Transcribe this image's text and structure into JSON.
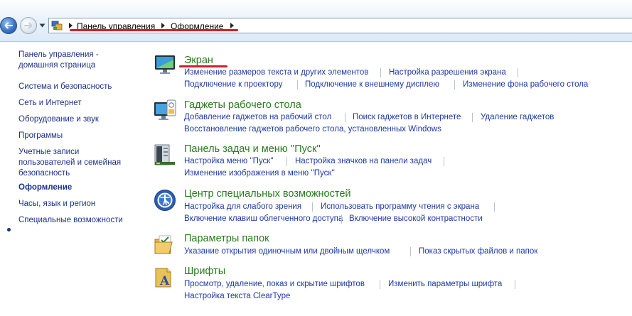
{
  "breadcrumb": {
    "items": [
      "Панель управления",
      "Оформление"
    ]
  },
  "sidebar": {
    "items": [
      {
        "label": "Панель управления -\nдомашняя страница"
      },
      {
        "label": "Система и безопасность"
      },
      {
        "label": "Сеть и Интернет"
      },
      {
        "label": "Оборудование и звук"
      },
      {
        "label": "Программы"
      },
      {
        "label": "Учетные записи\nпользователей и семейная\nбезопасность"
      },
      {
        "label": "Оформление",
        "current": true
      },
      {
        "label": "Часы, язык и регион"
      },
      {
        "label": "Специальные возможности"
      }
    ]
  },
  "categories": [
    {
      "title": "Экран",
      "icon": "display-icon",
      "links": [
        [
          "Изменение размеров текста и других элементов",
          "Настройка разрешения экрана"
        ],
        [
          "Подключение к проектору",
          "Подключение к внешнему дисплею",
          "Изменение фона рабочего стола"
        ]
      ]
    },
    {
      "title": "Гаджеты рабочего стола",
      "icon": "gadgets-icon",
      "links": [
        [
          "Добавление гаджетов на рабочий стол",
          "Поиск гаджетов в Интернете",
          "Удаление гаджетов"
        ],
        [
          "Восстановление гаджетов рабочего стола, установленных Windows"
        ]
      ]
    },
    {
      "title": "Панель задач и меню ''Пуск''",
      "icon": "taskbar-icon",
      "links": [
        [
          "Настройка меню ''Пуск''",
          "Настройка значков на панели задач"
        ],
        [
          "Изменение изображения в меню ''Пуск''"
        ]
      ]
    },
    {
      "title": "Центр специальных возможностей",
      "icon": "ease-of-access-icon",
      "links": [
        [
          "Настройка для слабого зрения",
          "Использовать программу чтения с экрана"
        ],
        [
          "Включение клавиш облегченного доступа",
          "Включение высокой контрастности"
        ]
      ]
    },
    {
      "title": "Параметры папок",
      "icon": "folder-options-icon",
      "links": [
        [
          "Указание открытия одиночным или двойным щелчком",
          "Показ скрытых файлов и папок"
        ]
      ]
    },
    {
      "title": "Шрифты",
      "icon": "fonts-icon",
      "links": [
        [
          "Просмотр, удаление, показ и скрытие шрифтов",
          "Изменить параметры шрифта"
        ],
        [
          "Настройка текста ClearType"
        ]
      ]
    }
  ],
  "colors": {
    "link": "#1e3aa0",
    "category_title": "#2a7a1f",
    "sidebar_link": "#1e3287",
    "annotation_underline": "#d11f28"
  }
}
